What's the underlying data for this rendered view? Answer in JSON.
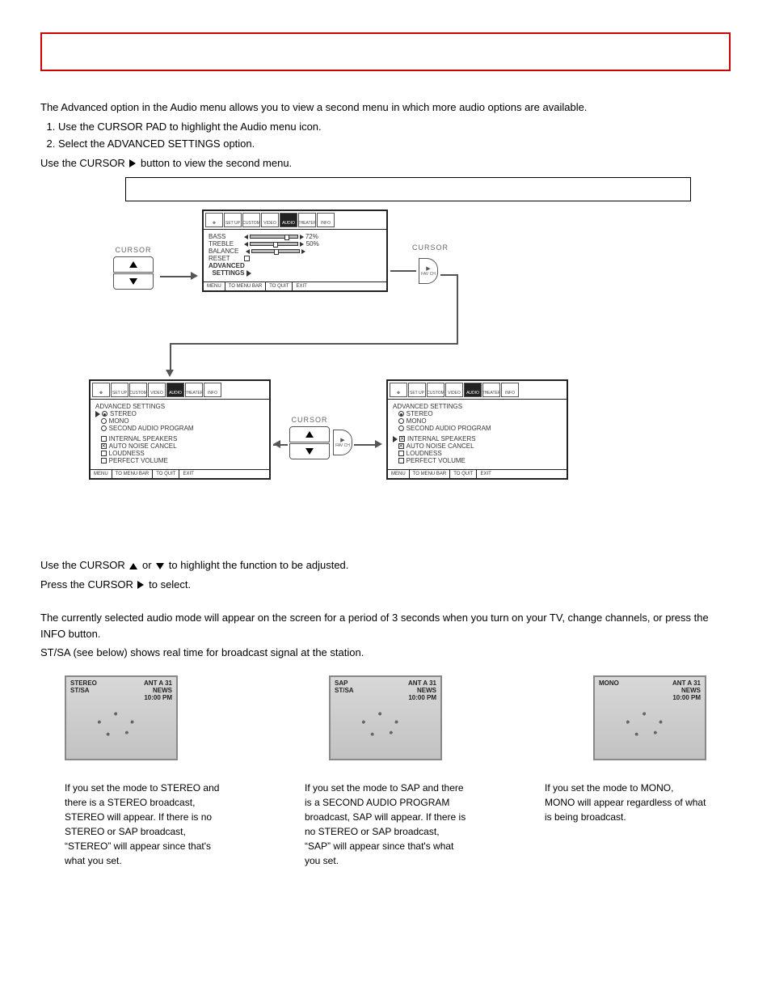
{
  "title_box": "",
  "intro": {
    "p1": "The Advanced option in the Audio menu allows you to view a second menu in which more audio options are available.",
    "steps": [
      "Use the CURSOR PAD to highlight the Audio menu icon.",
      "Select the ADVANCED SETTINGS option."
    ],
    "p2_prefix": "Use the CURSOR ",
    "p2_suffix": " button to view the second menu."
  },
  "diagram": {
    "cursor_label": "CURSOR",
    "fav_top": "▶",
    "fav_text": "FAV CH",
    "icon_tabs": [
      "SET UP",
      "CUSTOM",
      "VIDEO",
      "AUDIO",
      "THEATER",
      "INFO"
    ],
    "osd1": {
      "items": [
        "BASS",
        "TREBLE",
        "BALANCE",
        "RESET",
        "ADVANCED",
        "SETTINGS"
      ],
      "bass_pct": "72%",
      "treble_pct": "50%"
    },
    "osd2": {
      "title": "ADVANCED SETTINGS",
      "radio": [
        "STEREO",
        "MONO",
        "SECOND AUDIO PROGRAM"
      ],
      "checks": [
        "INTERNAL SPEAKERS",
        "AUTO NOISE CANCEL",
        "LOUDNESS",
        "PERFECT VOLUME"
      ]
    },
    "footer": [
      "MENU",
      "TO MENU BAR",
      "TO QUIT",
      "EXIT"
    ]
  },
  "post_diagram": {
    "line1_a": "Use the CURSOR ",
    "line1_b": " or ",
    "line1_c": " to highlight the function to be adjusted.",
    "line2_a": "Press the CURSOR ",
    "line2_b": " to select."
  },
  "audio_mode": {
    "line1": "The currently selected audio mode will appear on the screen for a period of 3 seconds when you turn on your TV, change channels, or press the INFO button.",
    "line2": "ST/SA (see below) shows real time for broadcast signal at the station."
  },
  "thumbs": [
    {
      "left_top": "STEREO",
      "left_bot": "ST/SA",
      "right": [
        "ANT A 31",
        "NEWS",
        "10:00 PM"
      ]
    },
    {
      "left_top": "SAP",
      "left_bot": "ST/SA",
      "right": [
        "ANT A 31",
        "NEWS",
        "10:00 PM"
      ]
    },
    {
      "left_top": "MONO",
      "left_bot": "",
      "right": [
        "ANT A 31",
        "NEWS",
        "10:00 PM"
      ]
    }
  ],
  "captions": {
    "c1": "If you set the mode to STEREO and there is a STEREO broadcast, STEREO will appear. If there is no STEREO or SAP broadcast, “STEREO” will appear since that's what you set.",
    "c2": "If you set the mode to SAP and there is a SECOND AUDIO PROGRAM broadcast, SAP will appear. If there is no STEREO or SAP broadcast, “SAP” will appear since that's what you set.",
    "c3": "If you set the mode to MONO, MONO will appear regardless of what is being broadcast."
  }
}
